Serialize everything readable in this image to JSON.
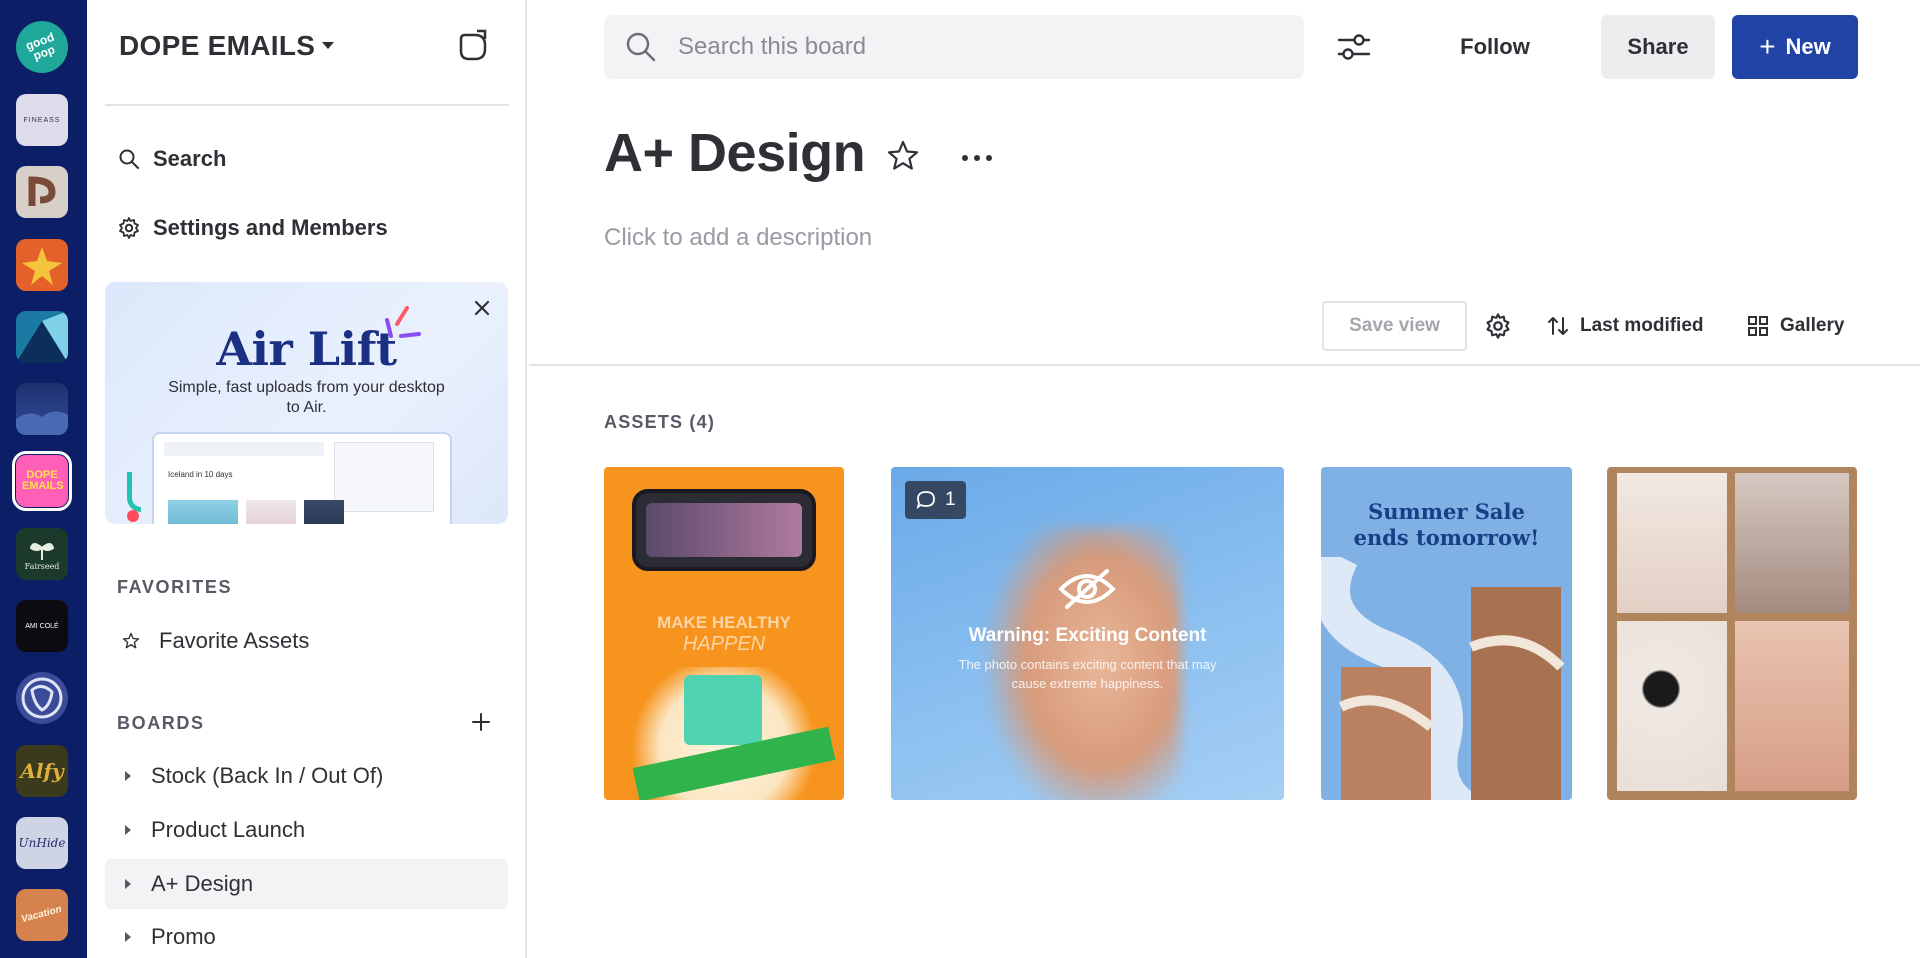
{
  "workspaces": [
    {
      "id": "goodpop",
      "label": "good pop",
      "bg": "#1fa79a",
      "fg": "#ffffff"
    },
    {
      "id": "fineass",
      "label": "FINEASS",
      "bg": "#dcdcea",
      "fg": "#333344"
    },
    {
      "id": "p-logo",
      "label": "",
      "bg": "#d8cfc8",
      "fg": "#7a4b3a"
    },
    {
      "id": "orange-star",
      "label": "",
      "bg": "#e4612a",
      "fg": "#f4c53b"
    },
    {
      "id": "teal-fold",
      "label": "",
      "bg": "#1a7aa3",
      "fg": "#0b2f5a"
    },
    {
      "id": "night-sky",
      "label": "",
      "bg": "#1f2f6e",
      "fg": "#4b6ab4"
    },
    {
      "id": "dope-emails",
      "label": "DOPE EMAILS",
      "bg": "#ff5fb6",
      "fg": "#ffe14a",
      "active": true
    },
    {
      "id": "fairseed",
      "label": "Fairseed",
      "bg": "#1c3a2b",
      "fg": "#e6efe0"
    },
    {
      "id": "ami-cole",
      "label": "AMI COLÉ",
      "bg": "#0b0b10",
      "fg": "#ffffff"
    },
    {
      "id": "dog",
      "label": "",
      "bg": "#3b4b9a",
      "fg": "#dfe4f7"
    },
    {
      "id": "alfy",
      "label": "Alfy",
      "bg": "#3b3a1c",
      "fg": "#e0b13a"
    },
    {
      "id": "unhide",
      "label": "UnHide",
      "bg": "#cfd3e6",
      "fg": "#2a2a6a"
    },
    {
      "id": "vacation",
      "label": "Vacation",
      "bg": "#d5824e",
      "fg": "#fff3d9"
    }
  ],
  "sidebar": {
    "workspace_name": "DOPE EMAILS",
    "search_label": "Search",
    "settings_label": "Settings and Members",
    "promo": {
      "title": "Air Lift",
      "text": "Simple, fast uploads from your desktop to Air.",
      "screen_caption": "Iceland in 10 days"
    },
    "favorites_heading": "FAVORITES",
    "favorite_assets_label": "Favorite Assets",
    "boards_heading": "BOARDS",
    "boards": [
      {
        "label": "Stock (Back In / Out Of)",
        "selected": false
      },
      {
        "label": "Product Launch",
        "selected": false
      },
      {
        "label": "A+ Design",
        "selected": true
      },
      {
        "label": "Promo",
        "selected": false
      }
    ]
  },
  "header": {
    "search_placeholder": "Search this board",
    "follow_label": "Follow",
    "share_label": "Share",
    "new_label": "New"
  },
  "board": {
    "title": "A+ Design",
    "description_placeholder": "Click to add a description",
    "save_view_label": "Save view",
    "sort_label": "Last modified",
    "view_label": "Gallery",
    "assets_heading": "ASSETS (4)"
  },
  "assets": [
    {
      "name": "Make healthy happen",
      "caption_line1": "MAKE HEALTHY",
      "caption_line2": "HAPPEN",
      "comments": null
    },
    {
      "name": "Warning: Exciting Content",
      "caption_line1": "Warning: Exciting Content",
      "caption_line2": "The photo contains exciting content that may cause extreme happiness.",
      "comments": "1"
    },
    {
      "name": "Summer Sale ends tomorrow!",
      "caption_line1": "Summer Sale",
      "caption_line2": "ends tomorrow!",
      "comments": null
    },
    {
      "name": "Collage",
      "caption_line1": "",
      "caption_line2": "",
      "comments": null
    }
  ],
  "colors": {
    "rail": "#0c1f66",
    "primary": "#2143a6",
    "text": "#2f2f36",
    "muted": "#9a9aa4"
  }
}
